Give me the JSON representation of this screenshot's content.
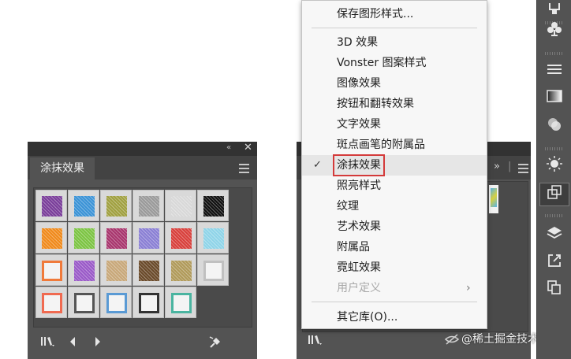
{
  "left_panel": {
    "tab_label": "涂抹效果",
    "close_glyph": "✕",
    "collapse_glyph": "«",
    "icons": {
      "menu": "hamburger-icon",
      "library": "library-icon",
      "prev": "triangle-left-icon",
      "next": "triangle-right-icon",
      "break_link": "break-link-icon"
    },
    "swatches": [
      {
        "name": "purple-blue-scribble",
        "color": "#7a3e9a"
      },
      {
        "name": "blue-gradient",
        "color": "#3b93d6"
      },
      {
        "name": "green-gold-hatch",
        "color": "#a0a040"
      },
      {
        "name": "gray-scribble",
        "color": "#9a9a9a"
      },
      {
        "name": "light-gray-hatch",
        "color": "#d8d8d8"
      },
      {
        "name": "black-scribble",
        "color": "#111111"
      },
      {
        "name": "orange-scribble",
        "color": "#f08a1c"
      },
      {
        "name": "green-scribble",
        "color": "#7cc443"
      },
      {
        "name": "magenta-square",
        "color": "#a8356d"
      },
      {
        "name": "purple-scribble",
        "color": "#8a7fd4"
      },
      {
        "name": "red-lines",
        "color": "#d8403c"
      },
      {
        "name": "light-blue-square",
        "color": "#8fd4e8"
      },
      {
        "name": "orange-frame",
        "color": "#f07a3a"
      },
      {
        "name": "violet-scribble",
        "color": "#9a5ac8"
      },
      {
        "name": "tan-lines",
        "color": "#c8a87a"
      },
      {
        "name": "brown-lines",
        "color": "#6a4a2a"
      },
      {
        "name": "multicolor-hatch",
        "color": "#b09a5a"
      },
      {
        "name": "thin-gray-frame",
        "color": "#c0c0c0"
      },
      {
        "name": "salmon-frame",
        "color": "#f06a50"
      },
      {
        "name": "dark-gray-frame",
        "color": "#555555"
      },
      {
        "name": "blue-frame",
        "color": "#5a9ad4"
      },
      {
        "name": "black-frame",
        "color": "#333333"
      },
      {
        "name": "green-blue-frame",
        "color": "#4ab4a0"
      }
    ]
  },
  "menu": {
    "items": [
      {
        "label": "保存图形样式...",
        "state": "normal"
      },
      {
        "label": "3D 效果",
        "state": "normal"
      },
      {
        "label": "Vonster 图案样式",
        "state": "normal"
      },
      {
        "label": "图像效果",
        "state": "normal"
      },
      {
        "label": "按钮和翻转效果",
        "state": "normal"
      },
      {
        "label": "文字效果",
        "state": "normal"
      },
      {
        "label": "斑点画笔的附属品",
        "state": "normal"
      },
      {
        "label": "涂抹效果",
        "state": "checked"
      },
      {
        "label": "照亮样式",
        "state": "normal"
      },
      {
        "label": "纹理",
        "state": "normal"
      },
      {
        "label": "艺术效果",
        "state": "normal"
      },
      {
        "label": "附属品",
        "state": "normal"
      },
      {
        "label": "霓虹效果",
        "state": "normal"
      },
      {
        "label": "用户定义",
        "state": "disabled"
      },
      {
        "label": "其它库(O)...",
        "state": "normal"
      }
    ],
    "check_glyph": "✓",
    "submenu_glyph": "›"
  },
  "right_panel": {
    "expand_glyph": "»",
    "icons": {
      "menu": "hamburger-icon",
      "library": "library-icon",
      "visibility": "hidden-eye-icon"
    }
  },
  "watermark": "@稀土掘金技术社区",
  "tool_strip": {
    "tools": [
      "graphic-styles-icon",
      "club-symbols-icon",
      "lines-icon",
      "gradient-icon",
      "transparency-icon",
      "brightness-icon",
      "artboard-icon",
      "layers-icon",
      "export-icon",
      "pages-icon"
    ]
  }
}
